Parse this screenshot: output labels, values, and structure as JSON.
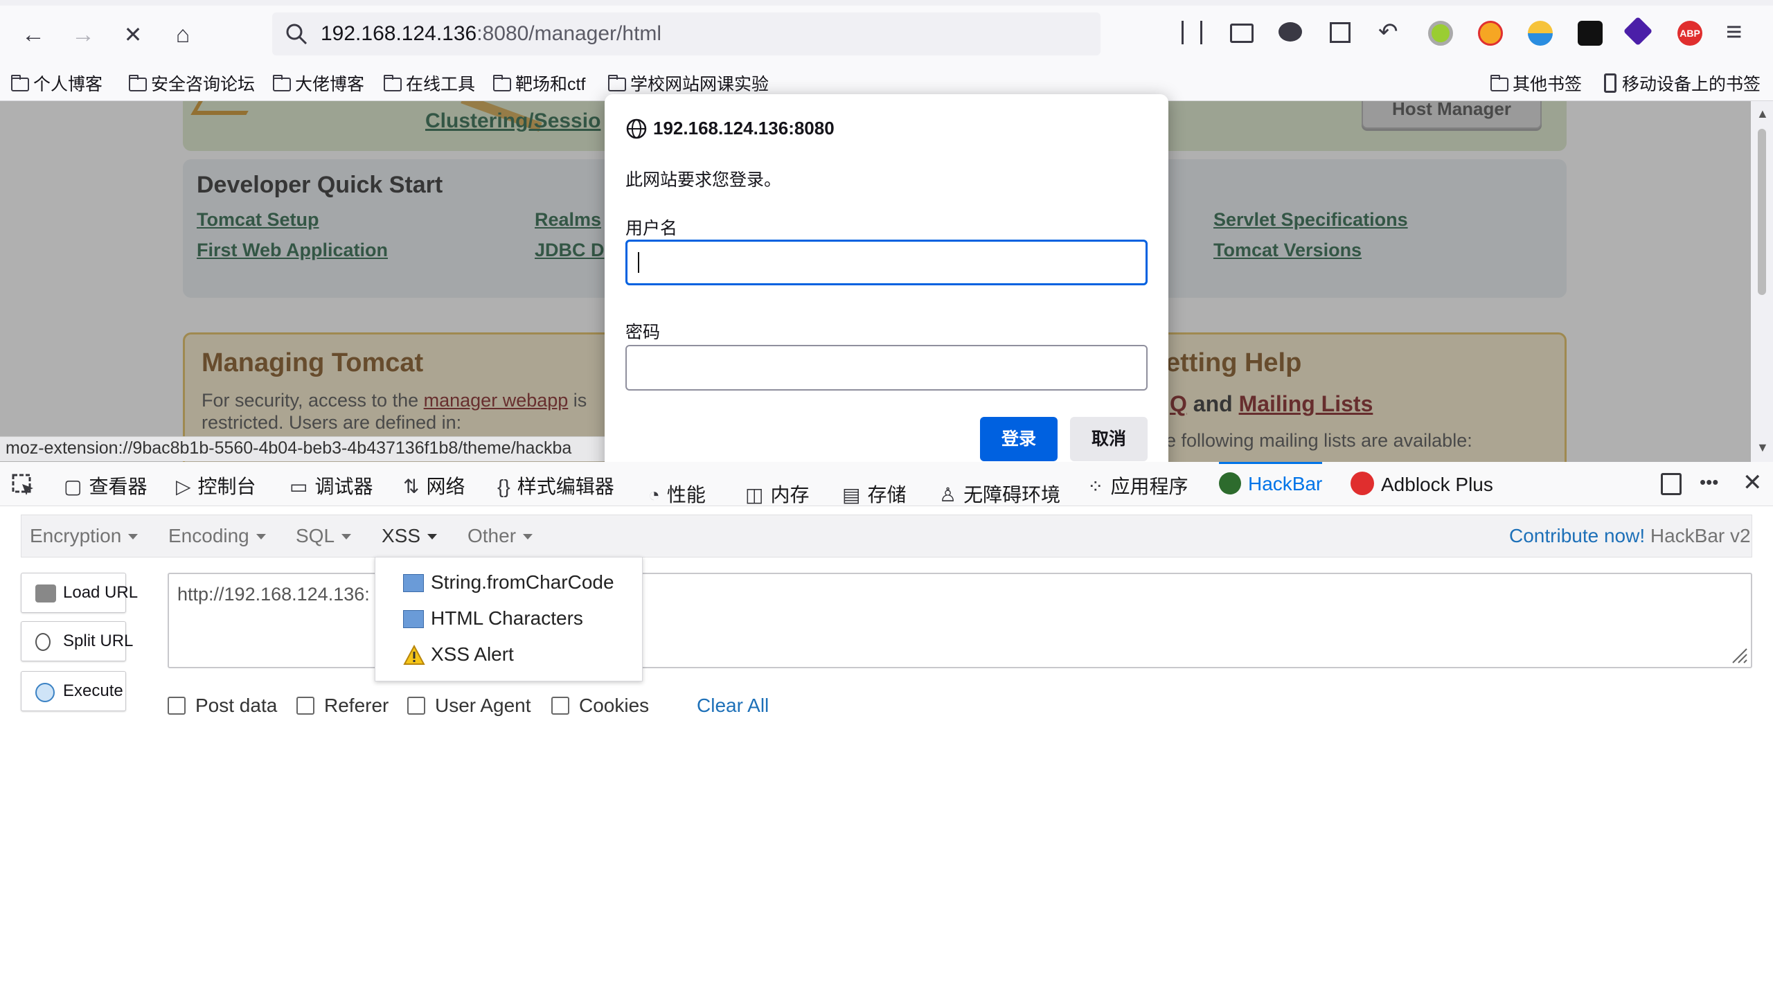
{
  "toolbar": {
    "url_host": "192.168.124.136",
    "url_rest": ":8080/manager/html",
    "back_icon": "←",
    "forward_icon": "→",
    "stop_icon": "✕",
    "home_icon": "⌂",
    "menu_icon": "≡",
    "abp_label": "ABP"
  },
  "bookmarks": {
    "items": [
      "个人博客",
      "安全咨询论坛",
      "大佬博客",
      "在线工具",
      "靶场和ctf",
      "学校网站网课实验"
    ],
    "other": "其他书签",
    "mobile": "移动设备上的书签"
  },
  "page": {
    "clustering_link": "Clustering/Sessio",
    "host_manager": "Host Manager",
    "dev_quick_start": "Developer Quick Start",
    "links_col1": [
      "Tomcat Setup",
      "First Web Application"
    ],
    "links_col2": [
      "Realms",
      "JDBC D"
    ],
    "links_col3": [
      "Servlet Specifications",
      "Tomcat Versions"
    ],
    "managing_title": "Managing Tomcat",
    "managing_text_1a": "For security, access to the ",
    "managing_link": "manager webapp",
    "managing_text_1b": " is",
    "managing_text_2": "restricted. Users are defined in:",
    "getting_help": "etting Help",
    "faq_tail": "Q",
    "and_text": " and ",
    "mailing_lists": "Mailing Lists",
    "mailing_text": "e following mailing lists are available:",
    "status_url": "moz-extension://9bac8b1b-5560-4b04-beb3-4b437136f1b8/theme/hackba"
  },
  "dialog": {
    "origin": "192.168.124.136:8080",
    "message": "此网站要求您登录。",
    "username_label": "用户名",
    "username_value": "",
    "password_label": "密码",
    "password_value": "",
    "login_button": "登录",
    "cancel_button": "取消"
  },
  "devtools": {
    "tabs": [
      "查看器",
      "控制台",
      "调试器",
      "网络",
      "样式编辑器",
      "性能",
      "内存",
      "存储",
      "无障碍环境",
      "应用程序"
    ],
    "hackbar_tab": "HackBar",
    "adblock_tab": "Adblock Plus",
    "more_icon": "•••",
    "close_icon": "✕"
  },
  "hackbar": {
    "menus": [
      "Encryption",
      "Encoding",
      "SQL",
      "XSS",
      "Other"
    ],
    "contribute_link": "Contribute now!",
    "version": " HackBar v2",
    "load_url": "Load URL",
    "split_url": "Split URL",
    "execute": "Execute",
    "url_value": "http://192.168.124.136:",
    "checkboxes": [
      "Post data",
      "Referer",
      "User Agent",
      "Cookies"
    ],
    "clear_all": "Clear All",
    "xss_items": [
      "String.fromCharCode",
      "HTML Characters",
      "XSS Alert"
    ]
  },
  "colors": {
    "accent_blue": "#0061e0",
    "tomcat_green": "#1d5c3c",
    "link_red": "#7a1313",
    "hackbar_blue": "#1d70b8"
  }
}
